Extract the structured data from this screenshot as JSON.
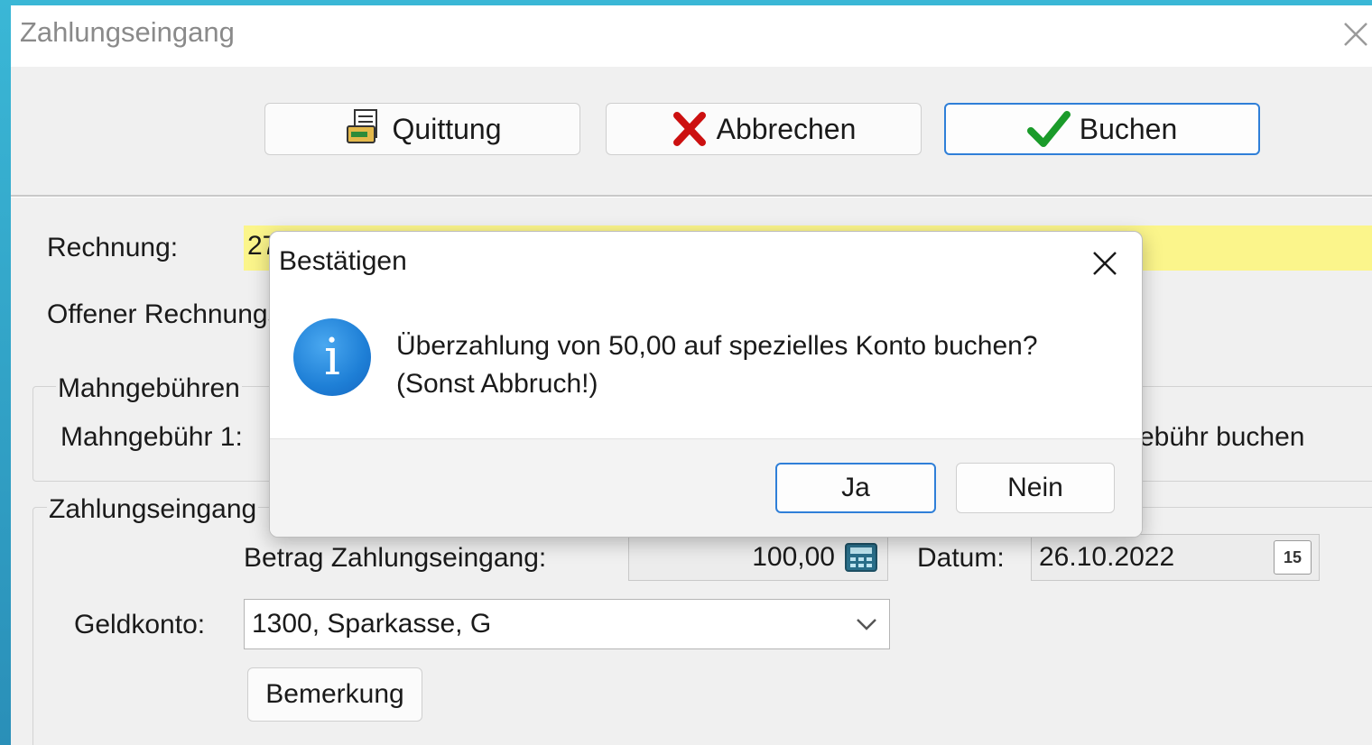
{
  "window": {
    "title": "Zahlungseingang"
  },
  "toolbar": {
    "quittung": "Quittung",
    "abbrechen": "Abbrechen",
    "buchen": "Buchen"
  },
  "form": {
    "rechnung_label": "Rechnung:",
    "rechnung_value": "27",
    "offener_label": "Offener Rechnungs",
    "mahn_group": "Mahngebühren",
    "mahn1_label": "Mahngebühr 1:",
    "mahn_buchen": "ebühr buchen",
    "zahlung_group": "Zahlungseingang",
    "betrag_label": "Betrag Zahlungseingang:",
    "betrag_value": "100,00",
    "datum_label": "Datum:",
    "datum_value": "26.10.2022",
    "calendar_day": "15",
    "geldkonto_label": "Geldkonto:",
    "geldkonto_value": "1300, Sparkasse, G",
    "bemerkung": "Bemerkung"
  },
  "dialog": {
    "title": "Bestätigen",
    "message_line1": "Überzahlung von 50,00 auf spezielles Konto buchen?",
    "message_line2": "(Sonst Abbruch!)",
    "yes": "Ja",
    "no": "Nein",
    "info_glyph": "i"
  },
  "colors": {
    "accent": "#2f7fd8",
    "highlight": "#fbf58b",
    "info": "#1e88e5"
  }
}
